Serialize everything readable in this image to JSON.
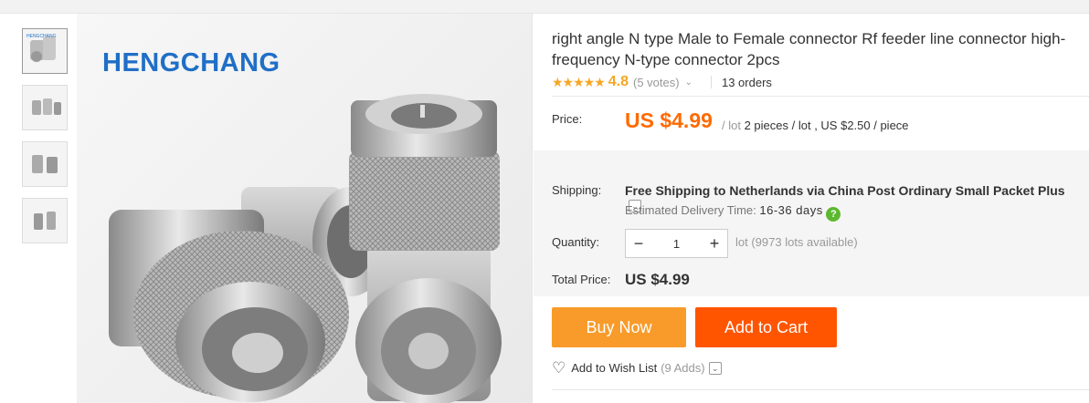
{
  "gallery": {
    "brand_watermark": "HENGCHANG",
    "thumbnails": [
      "thumb-1",
      "thumb-2",
      "thumb-3",
      "thumb-4"
    ]
  },
  "product": {
    "title": "right angle N type Male to Female connector Rf feeder line connector high-frequency N-type connector 2pcs",
    "stars": "★★★★★",
    "rating": "4.8",
    "votes": "(5 votes)",
    "orders": "13 orders"
  },
  "price": {
    "label": "Price:",
    "amount": "US $4.99",
    "unit": "/ lot",
    "detail": "2 pieces / lot , US $2.50 / piece"
  },
  "shipping": {
    "label": "Shipping:",
    "method": "Free Shipping to Netherlands via China Post Ordinary Small Packet Plus",
    "est_label": "Estimated Delivery Time:",
    "est_days": "16-36 days"
  },
  "quantity": {
    "label": "Quantity:",
    "minus": "−",
    "value": "1",
    "plus": "+",
    "available": "lot (9973 lots available)"
  },
  "total": {
    "label": "Total Price:",
    "amount": "US $4.99"
  },
  "actions": {
    "buy_now": "Buy Now",
    "add_to_cart": "Add to Cart",
    "wishlist": "Add to Wish List",
    "wishlist_adds": "(9 Adds)"
  },
  "colors": {
    "accent_orange": "#ff6a00",
    "buy_now": "#f89b2a",
    "add_to_cart": "#ff5500",
    "brand_blue": "#1f6fc7",
    "star": "#f5a623"
  }
}
